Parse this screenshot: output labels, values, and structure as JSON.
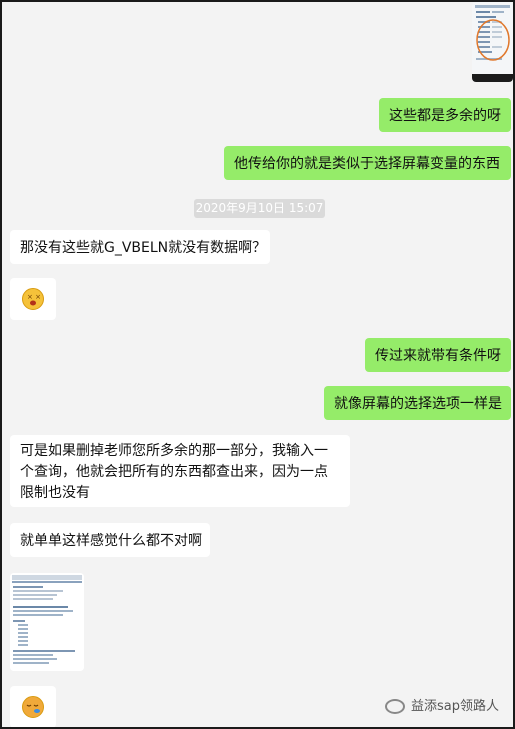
{
  "timestamp": "2020年9月10日 15:07",
  "messages": {
    "m1": "这些都是多余的呀",
    "m2": "他传给你的就是类似于选择屏幕变量的东西",
    "m3": "那没有这些就G_VBELN就没有数据啊？",
    "m4": "传过来就带有条件呀",
    "m5": "就像屏幕的选择选项一样是",
    "m6": "可是如果删掉老师您所多余的那一部分，我输入一个查询，他就会把所有的东西都查出来，因为一点限制也没有",
    "m7": "就单单这样感觉什么都不对啊"
  },
  "icons": {
    "emoji1": "dizzy-face-emoji",
    "emoji2": "sleepy-face-emoji",
    "watermark_icon": "wechat-channel-icon"
  },
  "watermark": "益添sap领路人",
  "colors": {
    "sent_bubble": "#95ec69",
    "received_bubble": "#ffffff",
    "chat_background": "#f3f3f3"
  }
}
